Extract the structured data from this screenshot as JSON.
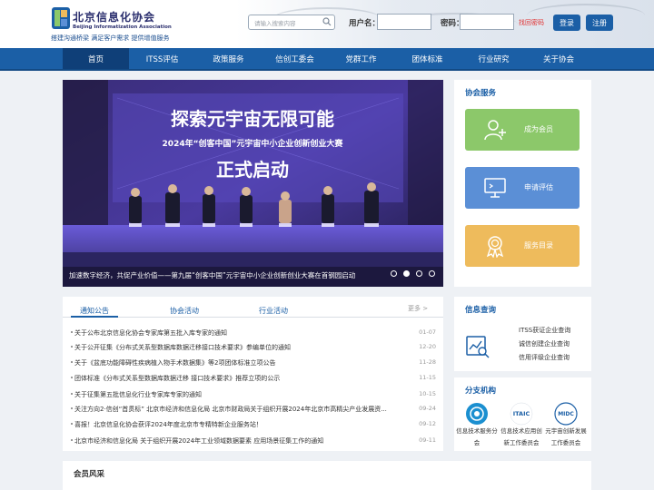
{
  "header": {
    "logo_cn": "北京信息化协会",
    "logo_en": "Beijing Informatization Association",
    "slogan": "搭建沟通桥梁 满足客户需求 提供增值服务",
    "search_placeholder": "请输入搜索内容",
    "username_label": "用户名：",
    "password_label": "密码：",
    "forgot_label": "找回密码",
    "login_label": "登录",
    "register_label": "注册"
  },
  "nav": {
    "items": [
      "首页",
      "ITSS评估",
      "政策服务",
      "信创工委会",
      "党群工作",
      "团体标准",
      "行业研究",
      "关于协会"
    ],
    "active_index": 0
  },
  "banner": {
    "headline": "探索元宇宙无限可能",
    "subline": "2024年“创客中国”元宇宙中小企业创新创业大赛",
    "launch": "正式启动",
    "caption": "加速数字经济，共促产业价值——第九届“创客中国”元宇宙中小企业创新创业大赛在首钢园启动",
    "slide_count": 4,
    "active_slide": 1
  },
  "services": {
    "title": "协会服务",
    "items": [
      {
        "label": "成为会员",
        "icon": "add-user-icon",
        "color": "#8cc86a"
      },
      {
        "label": "申请评估",
        "icon": "monitor-icon",
        "color": "#5b8fd6"
      },
      {
        "label": "服务目录",
        "icon": "medal-icon",
        "color": "#eebb5c"
      }
    ]
  },
  "news": {
    "tabs": [
      "通知公告",
      "协会活动",
      "行业活动"
    ],
    "more": "更多 >",
    "items": [
      {
        "title": "关于公布北京信息化协会专家库第五批入库专家的通知",
        "date": "01-07"
      },
      {
        "title": "关于公开征集《分布式关系型数据库数据迁移接口技术要求》参编单位的通知",
        "date": "12-20"
      },
      {
        "title": "关于《盆底功能障碍性疾病植入物手术数据集》等2项团体标准立项公告",
        "date": "11-28"
      },
      {
        "title": "团体标准《分布式关系型数据库数据迁移 接口技术要求》推荐立项的公示",
        "date": "11-15"
      },
      {
        "title": "关于征集第五批信息化行业专家库专家的通知",
        "date": "10-15"
      },
      {
        "title": "关注方向2·信创“首贯标” 北京市经济和信息化局 北京市财政局关于组织开展2024年北京市高精尖产业发展资...",
        "date": "09-24"
      },
      {
        "title": "喜报！北京信息化协会获评2024年度北京市专精特新企业服务站！",
        "date": "09-12"
      },
      {
        "title": "北京市经济和信息化局 关于组织开展2024年工业领域数据要素 应用场景征集工作的通知",
        "date": "09-11"
      }
    ]
  },
  "query": {
    "title": "信息查询",
    "items": [
      "ITSS获证企业查询",
      "诚信创建企业查询",
      "信用评级企业查询"
    ]
  },
  "branches": {
    "title": "分支机构",
    "items": [
      {
        "label": "信息技术服务分会",
        "logo_text": ""
      },
      {
        "label": "信息技术应用创新工作委员会",
        "logo_text": "ITAIC"
      },
      {
        "label": "元宇宙创新发展工作委员会",
        "logo_text": "MIDC"
      }
    ]
  },
  "members": {
    "title": "会员风采"
  },
  "colors": {
    "primary": "#1b5fa6",
    "nav_active": "#0f3f78",
    "green": "#8cc86a",
    "blue": "#5b8fd6",
    "yellow": "#eebb5c"
  }
}
